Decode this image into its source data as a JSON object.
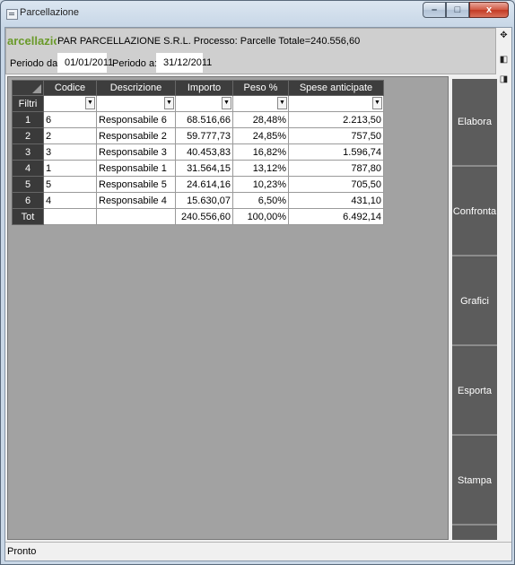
{
  "window": {
    "title": "Parcellazione",
    "controls": {
      "minimize": "–",
      "maximize": "□",
      "close": "x"
    }
  },
  "header": {
    "logo_text": "arcellazion",
    "process_line": "PAR PARCELLAZIONE S.R.L.   Processo: Parcelle Totale=240.556,60",
    "period_from_label": "Periodo da:",
    "period_from_value": "01/01/2011",
    "period_to_label": "Periodo a:",
    "period_to_value": "31/12/2011"
  },
  "table": {
    "columns": [
      "Codice",
      "Descrizione",
      "Importo",
      "Peso %",
      "Spese anticipate"
    ],
    "filter_label": "Filtri",
    "rows": [
      {
        "n": "1",
        "codice": "6",
        "descrizione": "Responsabile 6",
        "importo": "68.516,66",
        "peso": "28,48%",
        "spese": "2.213,50"
      },
      {
        "n": "2",
        "codice": "2",
        "descrizione": "Responsabile 2",
        "importo": "59.777,73",
        "peso": "24,85%",
        "spese": "757,50"
      },
      {
        "n": "3",
        "codice": "3",
        "descrizione": "Responsabile 3",
        "importo": "40.453,83",
        "peso": "16,82%",
        "spese": "1.596,74"
      },
      {
        "n": "4",
        "codice": "1",
        "descrizione": "Responsabile 1",
        "importo": "31.564,15",
        "peso": "13,12%",
        "spese": "787,80"
      },
      {
        "n": "5",
        "codice": "5",
        "descrizione": "Responsabile 5",
        "importo": "24.614,16",
        "peso": "10,23%",
        "spese": "705,50"
      },
      {
        "n": "6",
        "codice": "4",
        "descrizione": "Responsabile 4",
        "importo": "15.630,07",
        "peso": "6,50%",
        "spese": "431,10"
      }
    ],
    "total": {
      "label": "Tot",
      "importo": "240.556,60",
      "peso": "100,00%",
      "spese": "6.492,14"
    }
  },
  "buttons": [
    "Elabora",
    "Confronta",
    "Grafici",
    "Esporta",
    "Stampa"
  ],
  "status": {
    "text": "Pronto"
  },
  "icons": [
    "app-icon",
    "pin-icon",
    "panel-left-icon",
    "panel-right-icon",
    "dropdown-arrow-icon"
  ]
}
